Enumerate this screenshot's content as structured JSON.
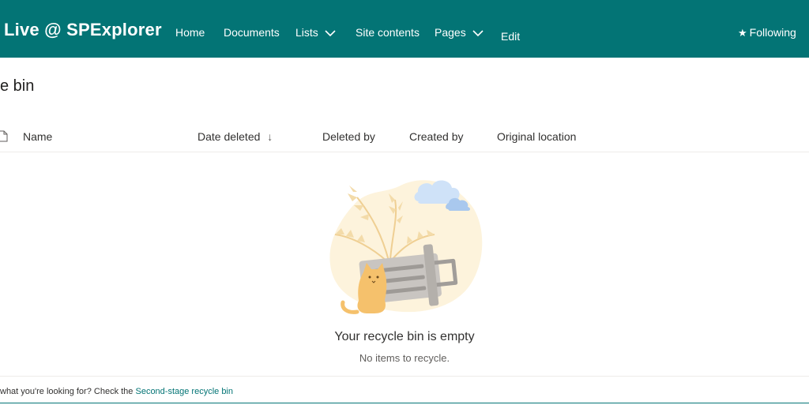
{
  "header": {
    "site_title": "Live @ SPExplorer",
    "nav": [
      {
        "label": "Home"
      },
      {
        "label": "Documents"
      },
      {
        "label": "Lists"
      },
      {
        "label": "Site contents"
      },
      {
        "label": "Pages"
      },
      {
        "label": "Edit"
      }
    ],
    "following_label": "Following",
    "following_icon": "star-icon",
    "background": "#037475"
  },
  "page": {
    "title": "e bin"
  },
  "table": {
    "columns": [
      "Name",
      "Date deleted",
      "Deleted by",
      "Created by",
      "Original location"
    ],
    "sort_indicator": "↓"
  },
  "empty_state": {
    "title": "Your recycle bin is empty",
    "subtitle": "No items to recycle."
  },
  "footer": {
    "prefix": "what you're looking for? Check the ",
    "link": "Second-stage recycle bin"
  }
}
